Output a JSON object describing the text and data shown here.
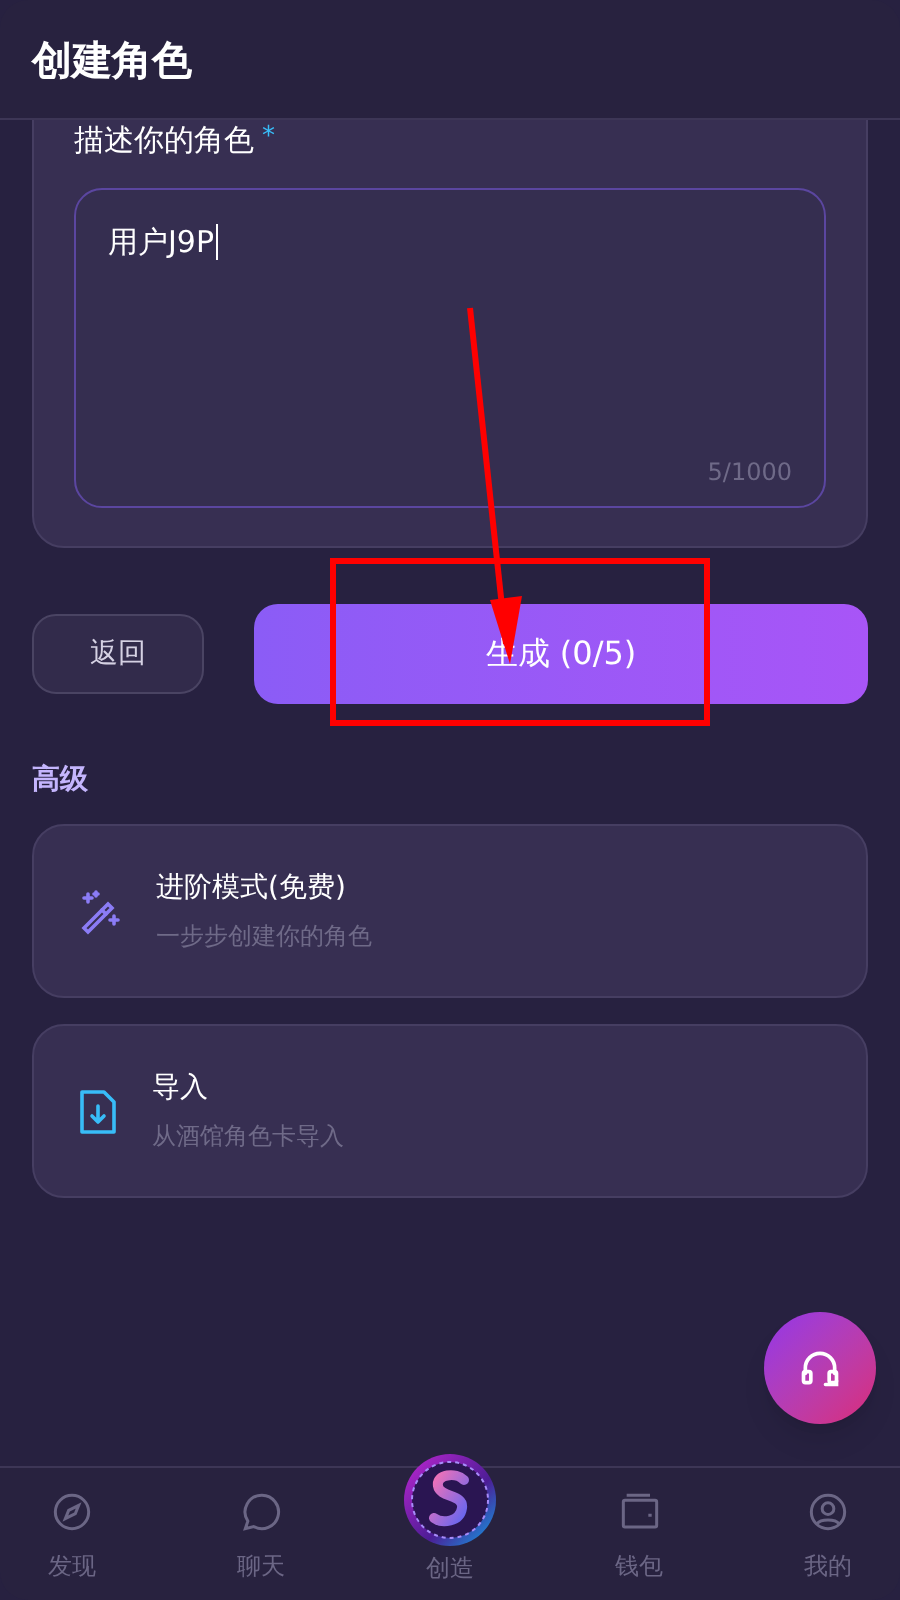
{
  "header": {
    "title": "创建角色"
  },
  "form": {
    "label": "描述你的角色",
    "required_mark": "*",
    "value": "用户J9P",
    "counter": "5/1000"
  },
  "actions": {
    "back": "返回",
    "generate": "生成 (0/5)"
  },
  "advanced": {
    "title": "高级",
    "options": [
      {
        "kind": "wand",
        "title": "进阶模式(免费)",
        "subtitle": "一步步创建你的角色"
      },
      {
        "kind": "import",
        "title": "导入",
        "subtitle": "从酒馆角色卡导入"
      }
    ]
  },
  "bottom_nav": [
    {
      "kind": "compass",
      "label": "发现"
    },
    {
      "kind": "chat",
      "label": "聊天"
    },
    {
      "kind": "logo",
      "label": "创造"
    },
    {
      "kind": "wallet",
      "label": "钱包"
    },
    {
      "kind": "user",
      "label": "我的"
    }
  ],
  "annotations": {
    "arrow": true,
    "highlight_box": true
  }
}
